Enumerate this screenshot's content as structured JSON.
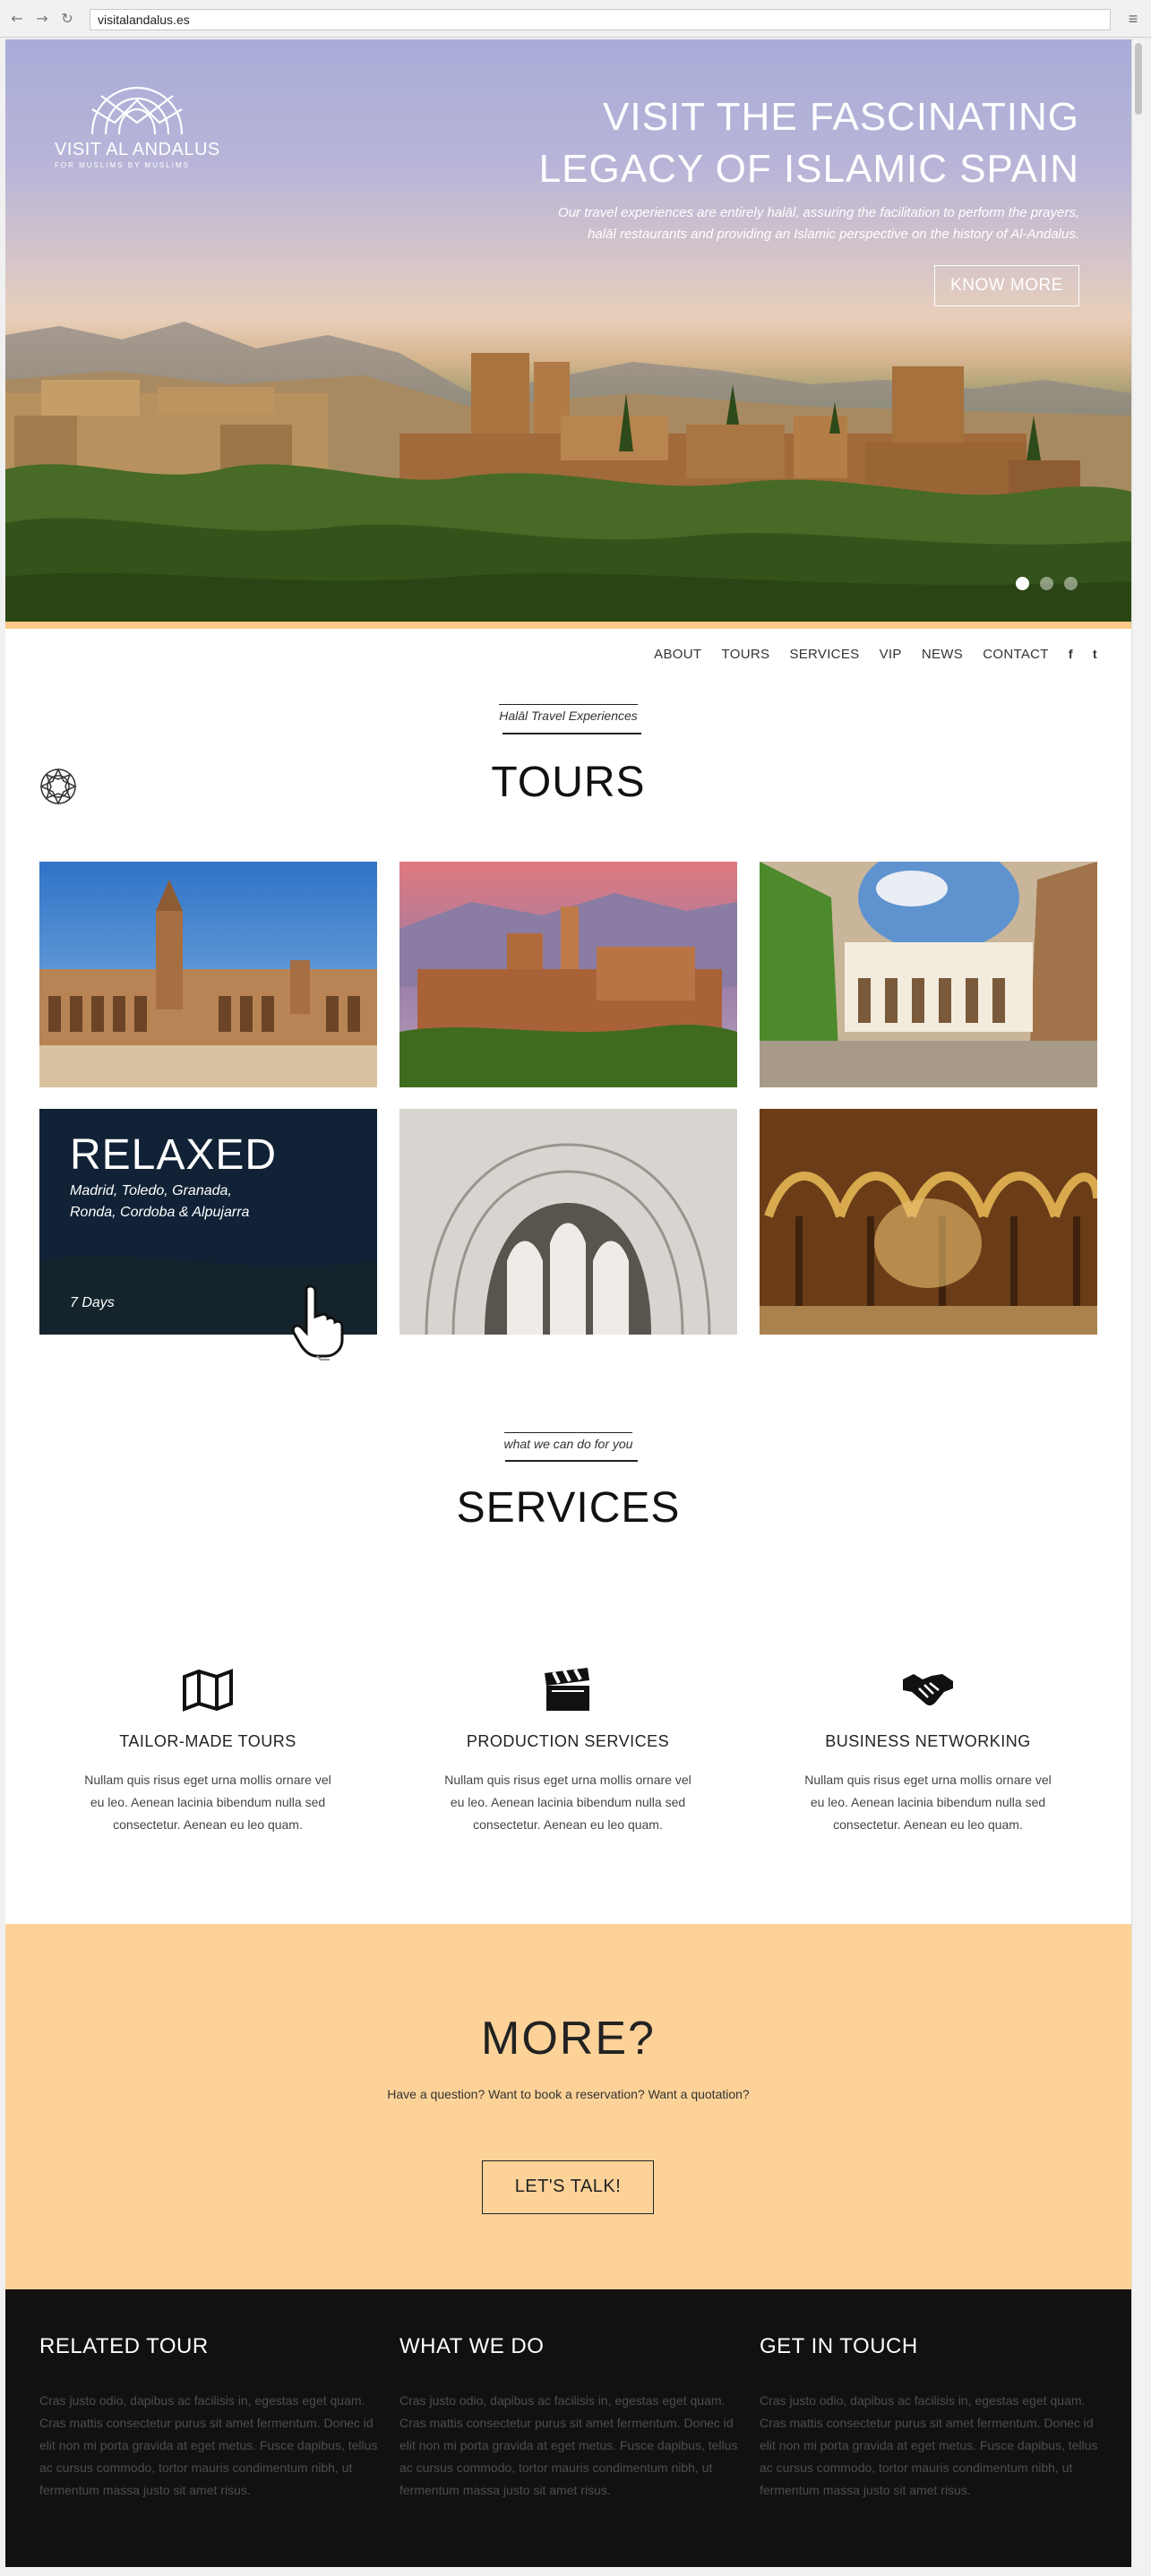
{
  "browser": {
    "url": "visitalandalus.es",
    "back_icon": "back-arrow-icon",
    "forward_icon": "forward-arrow-icon",
    "reload_icon": "reload-icon",
    "menu_icon": "hamburger-menu-icon"
  },
  "logo": {
    "title": "VISIT AL ANDALUS",
    "subtitle": "FOR MUSLIMS BY MUSLIMS"
  },
  "hero": {
    "title_line1": "VISIT THE FASCINATING",
    "title_line2": "LEGACY OF ISLAMIC SPAIN",
    "desc_line1": "Our travel experiences are entirely halāl, assuring the facilitation to perform the prayers,",
    "desc_line2": "halāl restaurants and providing an Islamic perspective on the history of Al-Andalus.",
    "button": "KNOW MORE",
    "slides": 3,
    "active_slide": 1
  },
  "nav": {
    "items": [
      "ABOUT",
      "TOURS",
      "SERVICES",
      "VIP",
      "NEWS",
      "CONTACT"
    ],
    "facebook": "f",
    "twitter": "t"
  },
  "tours": {
    "kicker": "Halāl Travel Experiences",
    "title": "TOURS",
    "featured": {
      "name": "RELAXED",
      "places_line1": "Madrid, Toledo, Granada,",
      "places_line2": "Ronda, Cordoba & Alpujarra",
      "days": "7 Days"
    }
  },
  "services": {
    "kicker": "what we can do for you",
    "title": "SERVICES",
    "items": [
      {
        "icon": "map-icon",
        "title": "TAILOR-MADE TOURS",
        "text": "Nullam quis risus eget urna mollis ornare vel eu leo. Aenean lacinia bibendum nulla sed consectetur. Aenean eu leo quam."
      },
      {
        "icon": "clapperboard-icon",
        "title": "PRODUCTION SERVICES",
        "text": "Nullam quis risus eget urna mollis ornare vel eu leo. Aenean lacinia bibendum nulla sed consectetur. Aenean eu leo quam."
      },
      {
        "icon": "handshake-icon",
        "title": "BUSINESS NETWORKING",
        "text": "Nullam quis risus eget urna mollis ornare vel eu leo. Aenean lacinia bibendum nulla sed consectetur. Aenean eu leo quam."
      }
    ]
  },
  "cta": {
    "title": "MORE?",
    "text": "Have a question? Want to book a reservation? Want a quotation?",
    "button": "LET'S TALK!"
  },
  "footer": {
    "columns": [
      {
        "title": "RELATED TOUR",
        "text": "Cras justo odio, dapibus ac facilisis in, egestas eget quam. Cras mattis consectetur purus sit amet fermentum. Donec id elit non mi porta gravida at eget metus. Fusce dapibus, tellus ac cursus commodo, tortor mauris condimentum nibh, ut fermentum massa justo sit amet risus."
      },
      {
        "title": "WHAT WE DO",
        "text": "Cras justo odio, dapibus ac facilisis in, egestas eget quam. Cras mattis consectetur purus sit amet fermentum. Donec id elit non mi porta gravida at eget metus. Fusce dapibus, tellus ac cursus commodo, tortor mauris condimentum nibh, ut fermentum massa justo sit amet risus."
      },
      {
        "title": "GET IN TOUCH",
        "text": "Cras justo odio, dapibus ac facilisis in, egestas eget quam. Cras mattis consectetur purus sit amet fermentum. Donec id elit non mi porta gravida at eget metus. Fusce dapibus, tellus ac cursus commodo, tortor mauris condimentum nibh, ut fermentum massa justo sit amet risus."
      }
    ]
  },
  "colors": {
    "accent": "#fdc988",
    "cta_bg": "#fdd298",
    "footer_bg": "#111111",
    "overlay": "#0a192d"
  }
}
